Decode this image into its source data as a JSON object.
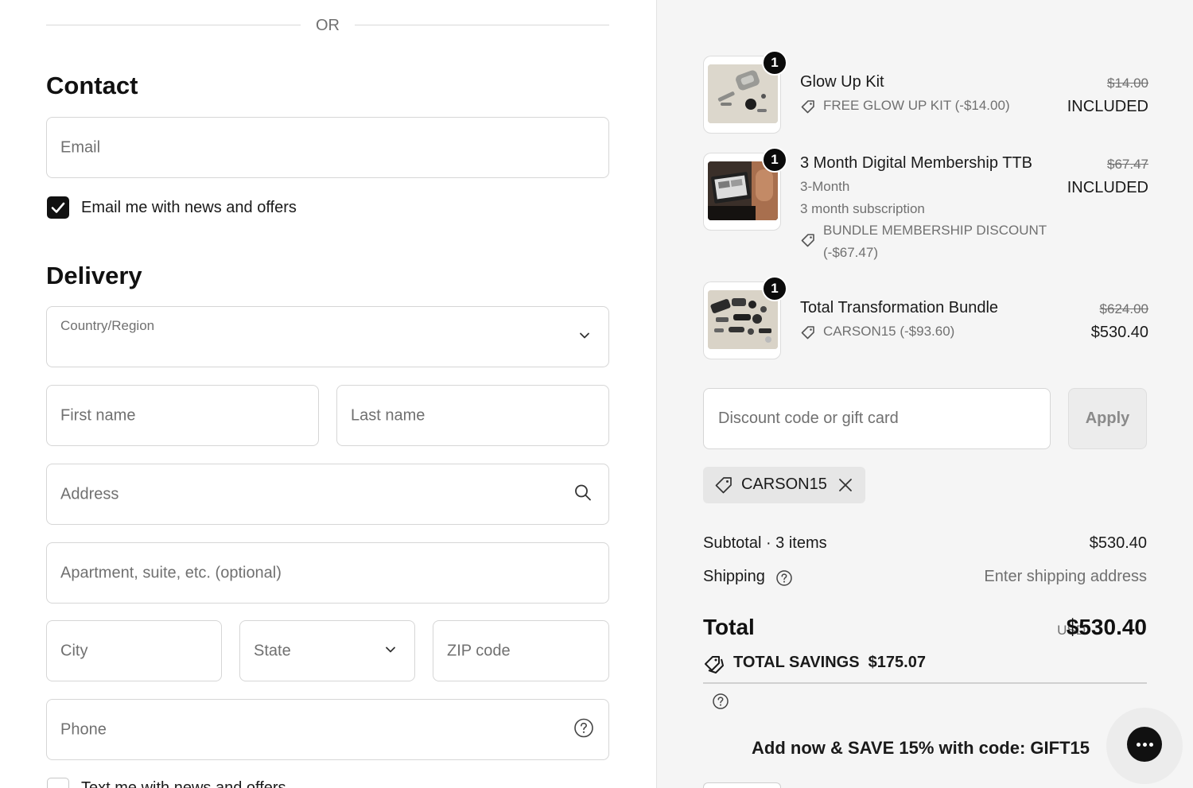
{
  "divider": {
    "or": "OR"
  },
  "contact": {
    "title": "Contact",
    "email_placeholder": "Email",
    "newsletter_label": "Email me with news and offers",
    "newsletter_checked": true
  },
  "delivery": {
    "title": "Delivery",
    "country_label": "Country/Region",
    "first_name": "First name",
    "last_name": "Last name",
    "address": "Address",
    "apartment": "Apartment, suite, etc. (optional)",
    "city": "City",
    "state": "State",
    "zip": "ZIP code",
    "phone": "Phone",
    "text_offers_label": "Text me with news and offers"
  },
  "cart": {
    "items": [
      {
        "quantity": "1",
        "name": "Glow Up Kit",
        "variant": "",
        "details": "",
        "discount": "FREE GLOW UP KIT (-$14.00)",
        "discount_line2": "",
        "original_price": "$14.00",
        "price": "INCLUDED"
      },
      {
        "quantity": "1",
        "name": "3 Month Digital Membership TTB",
        "variant": "3-Month",
        "details": "3 month subscription",
        "discount": "BUNDLE MEMBERSHIP DISCOUNT",
        "discount_line2": "(-$67.47)",
        "original_price": "$67.47",
        "price": "INCLUDED"
      },
      {
        "quantity": "1",
        "name": "Total Transformation Bundle",
        "variant": "",
        "details": "",
        "discount": "CARSON15 (-$93.60)",
        "discount_line2": "",
        "original_price": "$624.00",
        "price": "$530.40"
      }
    ]
  },
  "discount_code": {
    "placeholder": "Discount code or gift card",
    "apply_label": "Apply",
    "applied_code": "CARSON15"
  },
  "summary": {
    "subtotal_label": "Subtotal · 3 items",
    "subtotal_value": "$530.40",
    "shipping_label": "Shipping",
    "shipping_value": "Enter shipping address",
    "total_label": "Total",
    "currency": "USD",
    "total_value": "$530.40",
    "savings_label": "TOTAL SAVINGS",
    "savings_value": "$175.07"
  },
  "promo": {
    "text": "Add now & SAVE 15% with code: GIFT15"
  },
  "colors": {
    "primary": "#111111",
    "muted_text": "#707070",
    "sidebar_bg": "#f5f5f5",
    "border": "#d6d6d6"
  },
  "icons": {
    "select": "chevron-down-icon",
    "address_search": "search-icon",
    "phone_help": "help-circle-icon",
    "discount_tag": "tag-icon",
    "remove_code": "close-icon",
    "savings": "tags-icon",
    "chat": "chat-bubble-icon"
  }
}
